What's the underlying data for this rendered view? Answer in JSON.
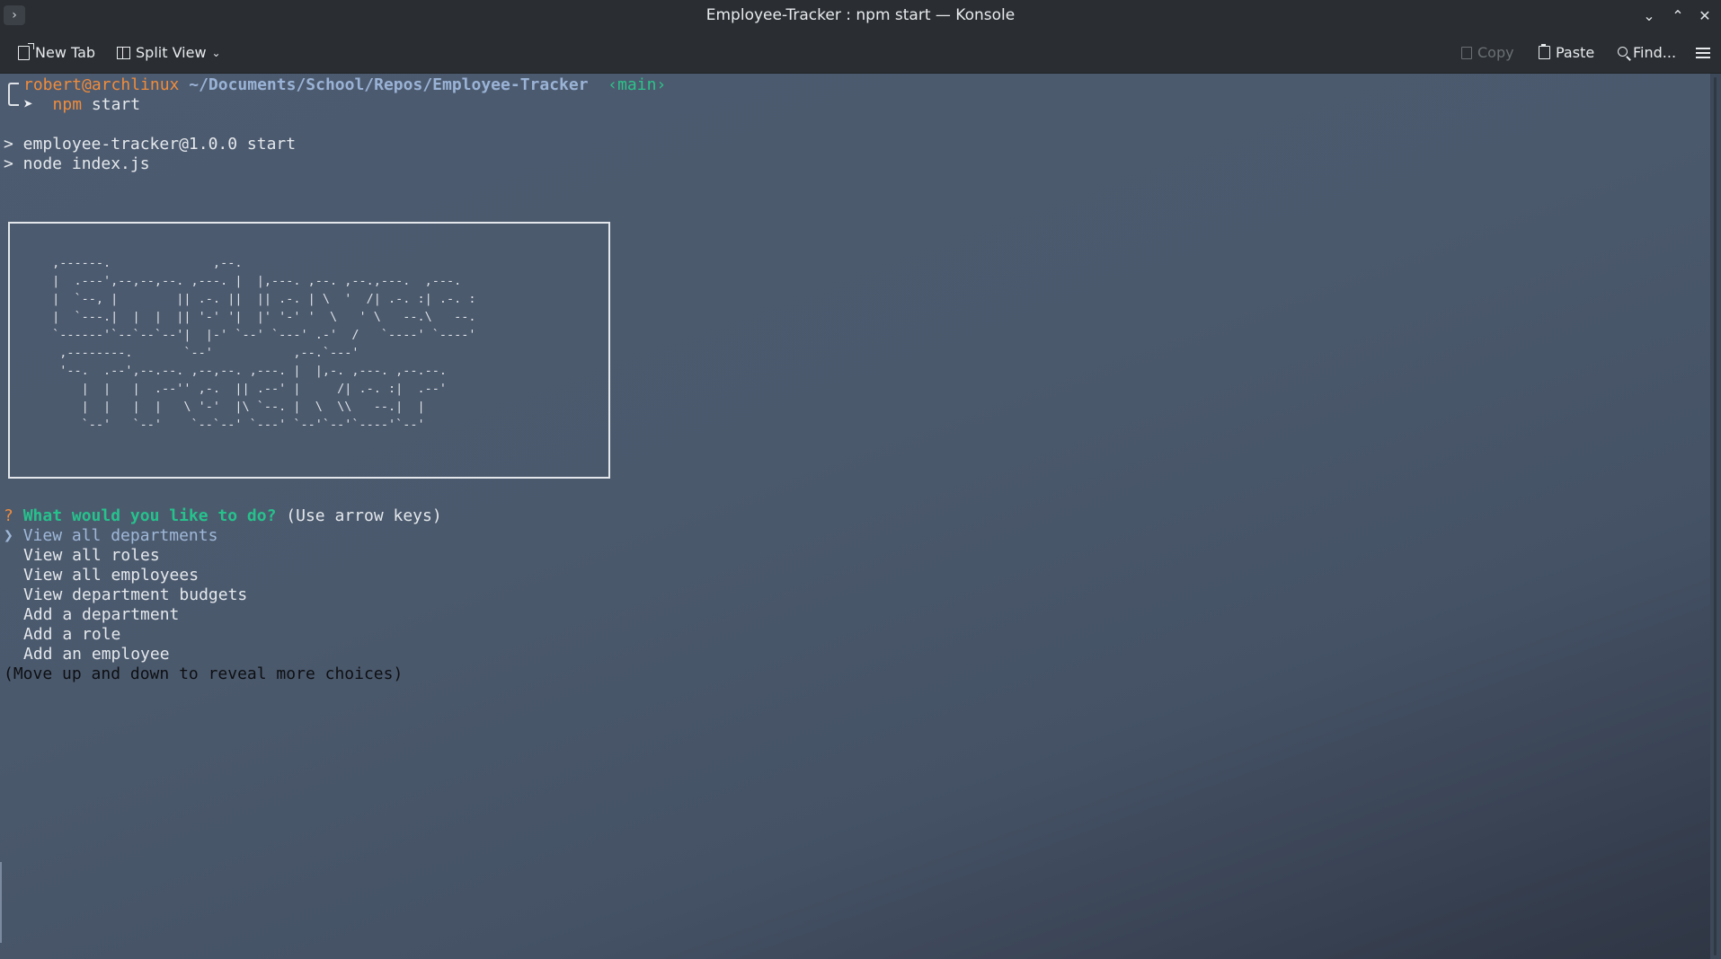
{
  "window": {
    "title": "Employee-Tracker : npm start — Konsole",
    "app_menu_glyph": "›",
    "controls": {
      "minimize_glyph": "⌄",
      "maximize_glyph": "⌃",
      "close_glyph": "✕"
    }
  },
  "toolbar": {
    "new_tab_label": "New Tab",
    "split_view_label": "Split View",
    "copy_label": "Copy",
    "paste_label": "Paste",
    "find_label": "Find...",
    "icons": {
      "new_tab": "new-tab-icon",
      "split_view": "split-view-icon",
      "copy": "copy-icon",
      "paste": "paste-icon",
      "find": "search-icon",
      "menu": "hamburger-menu-icon"
    }
  },
  "terminal": {
    "prompt": {
      "user_host": "robert@archlinux",
      "path": "~/Documents/School/Repos/Employee-Tracker",
      "branch": "‹main›",
      "arrow": "➤",
      "command_name": "npm",
      "command_args": "start"
    },
    "script_lines": [
      "> employee-tracker@1.0.0 start",
      "> node index.js"
    ],
    "banner_ascii": [
      " ,------.              ,--.",
      " |  .---',--,--,--. ,---. |  |,---. ,--. ,--.,---.  ,---.",
      " |  `--, |        || .-. ||  || .-. | \\  '  /| .-. :| .-. :",
      " |  `---.|  |  |  || '-' '|  |' '-' '  \\   ' \\   --.\\   --.",
      " `------'`--`--`--'|  |-' `--' `---' .-'  /   `----' `----'",
      "  ,--------.       `--'           ,--.`---'",
      "  '--.  .--',--.--. ,--,--. ,---. |  |,-. ,---. ,--.--.",
      "     |  |   |  .--'' ,-.  || .--' |     /| .-. :|  .--'",
      "     |  |   |  |   \\ '-'  |\\ `--. |  \\  \\\\   --.|  |",
      "     `--'   `--'    `--`--' `---' `--'`--'`----'`--'"
    ],
    "question": {
      "mark": "?",
      "text": "What would you like to do?",
      "hint": "(Use arrow keys)"
    },
    "menu": {
      "pointer": "❯",
      "selected_index": 0,
      "items": [
        "View all departments",
        "View all roles",
        "View all employees",
        "View department budgets",
        "Add a department",
        "Add a role",
        "Add an employee"
      ],
      "footer": "(Move up and down to reveal more choices)"
    }
  },
  "colors": {
    "prompt_user": "#f08c3b",
    "path": "#9ab3d6",
    "branch": "#2bc48a",
    "question": "#26c28c",
    "selected_item": "#9fb8d8",
    "titlebar_bg": "#2a2e32",
    "terminal_bg": "#4b596d"
  }
}
